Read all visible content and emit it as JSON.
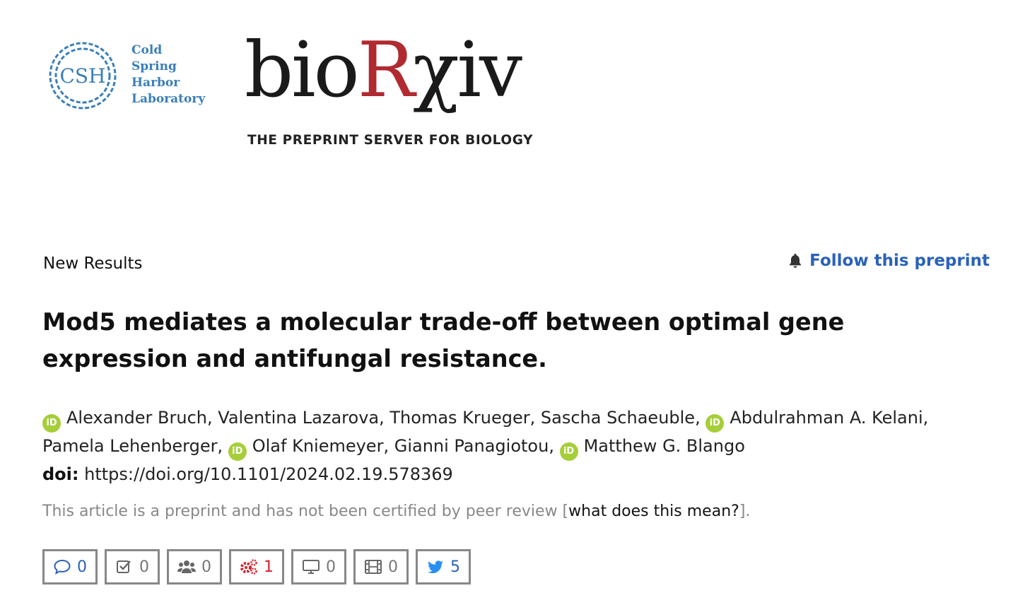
{
  "header": {
    "csh_abbrev": "CSH",
    "csh_words": [
      "Cold",
      "Spring",
      "Harbor",
      "Laboratory"
    ],
    "brand_bio": "bio",
    "brand_r": "R",
    "brand_chi": "χ",
    "brand_iv": "iv",
    "tagline": "THE PREPRINT SERVER FOR BIOLOGY",
    "colors": {
      "csh_blue": "#3a7fb8",
      "brand_red": "#b02a30"
    }
  },
  "article": {
    "section_label": "New Results",
    "follow_label": "Follow this preprint",
    "follow_icon": "bell-icon",
    "title": "Mod5 mediates a molecular trade-off between optimal gene expression and antifungal resistance.",
    "authors": [
      "Alexander Bruch,",
      "Valentina Lazarova,",
      "Thomas Krueger,",
      "Sascha Schaeuble,",
      "Abdulrahman A. Kelani,",
      "Pamela Lehenberger,",
      "Olaf Kniemeyer,",
      "Gianni Panagiotou,",
      "Matthew G. Blango"
    ],
    "orcid_badge": "iD",
    "doi_label": "doi:",
    "doi_url": "https://doi.org/10.1101/2024.02.19.578369",
    "notice_prefix": "This article is a preprint and has not been certified by peer review [",
    "notice_link": "what does this mean?",
    "notice_suffix": "]."
  },
  "metrics": {
    "comments": {
      "icon": "comment-icon",
      "count": "0",
      "color": "#2a62b8"
    },
    "reviews": {
      "icon": "checkbox-icon",
      "count": "0"
    },
    "community": {
      "icon": "users-icon",
      "count": "0"
    },
    "automated": {
      "icon": "gears-icon",
      "count": "1",
      "color": "#d4202a"
    },
    "posters": {
      "icon": "monitor-icon",
      "count": "0"
    },
    "videos": {
      "icon": "film-icon",
      "count": "0"
    },
    "twitter": {
      "icon": "twitter-icon",
      "count": "5",
      "color": "#2a62b8"
    }
  }
}
